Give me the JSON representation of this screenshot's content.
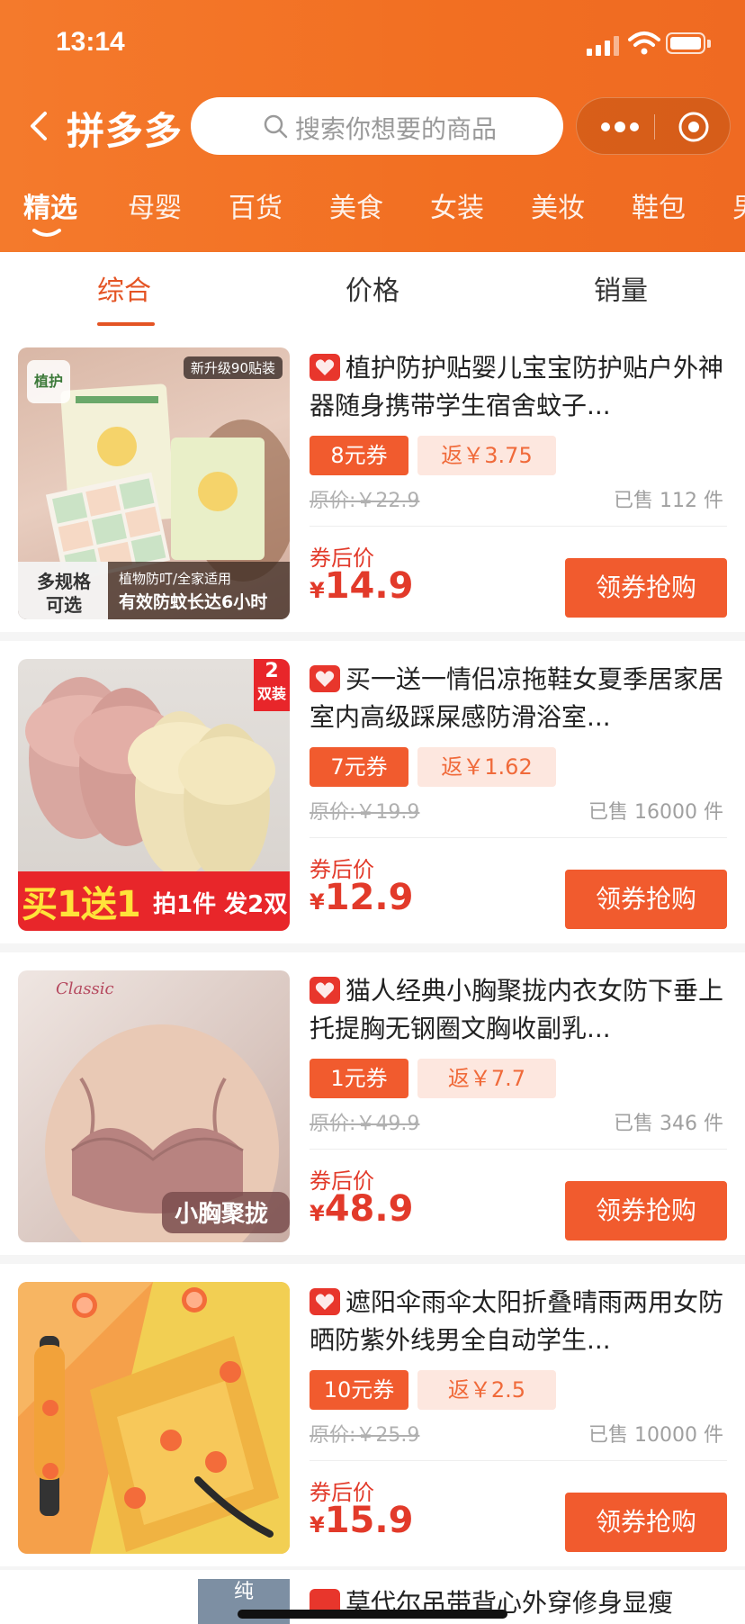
{
  "status": {
    "time": "13:14"
  },
  "nav": {
    "brand": "拼多多",
    "search_placeholder": "搜索你想要的商品"
  },
  "categories": [
    "精选",
    "母婴",
    "百货",
    "美食",
    "女装",
    "美妆",
    "鞋包",
    "男"
  ],
  "sort": {
    "tabs": [
      "综合",
      "价格",
      "销量"
    ],
    "active": 0
  },
  "products": [
    {
      "title": "植护防护贴婴儿宝宝防护贴户外神器随身携带学生宿舍蚊子...",
      "coupon": "8元券",
      "rebate": "返￥3.75",
      "original": "原价:￥22.9",
      "sold": "已售 112 件",
      "after_label": "券后价",
      "price": "14.9",
      "buy": "领券抢购",
      "image": {
        "brand": "植护",
        "badge": "新升级90贴装",
        "tag_top": "多规格",
        "tag_bottom": "可选",
        "caption1": "植物防叮/全家适用",
        "caption2": "有效防蚊长达6小时"
      }
    },
    {
      "title": "买一送一情侣凉拖鞋女夏季居家居室内高级踩屎感防滑浴室...",
      "coupon": "7元券",
      "rebate": "返￥1.62",
      "original": "原价:￥19.9",
      "sold": "已售 16000 件",
      "after_label": "券后价",
      "price": "12.9",
      "buy": "领券抢购",
      "image": {
        "badge_num": "2",
        "badge_text": "双装",
        "banner_big": "买1送1",
        "banner_small": "拍1件 发2双"
      }
    },
    {
      "title": "猫人经典小胸聚拢内衣女防下垂上托提胸无钢圈文胸收副乳...",
      "coupon": "1元券",
      "rebate": "返￥7.7",
      "original": "原价:￥49.9",
      "sold": "已售 346 件",
      "after_label": "券后价",
      "price": "48.9",
      "buy": "领券抢购",
      "image": {
        "logo": "Classic",
        "tag": "小胸聚拢"
      }
    },
    {
      "title": "遮阳伞雨伞太阳折叠晴雨两用女防晒防紫外线男全自动学生...",
      "coupon": "10元券",
      "rebate": "返￥2.5",
      "original": "原价:￥25.9",
      "sold": "已售 10000 件",
      "after_label": "券后价",
      "price": "15.9",
      "buy": "领券抢购",
      "image": {}
    }
  ],
  "partial": {
    "title": "莫代尔吊带背心外穿修身显瘦",
    "thumb_text": "纯"
  },
  "colors": {
    "accent": "#f15b2e",
    "price": "#e23a2a",
    "header": "#f27324"
  }
}
